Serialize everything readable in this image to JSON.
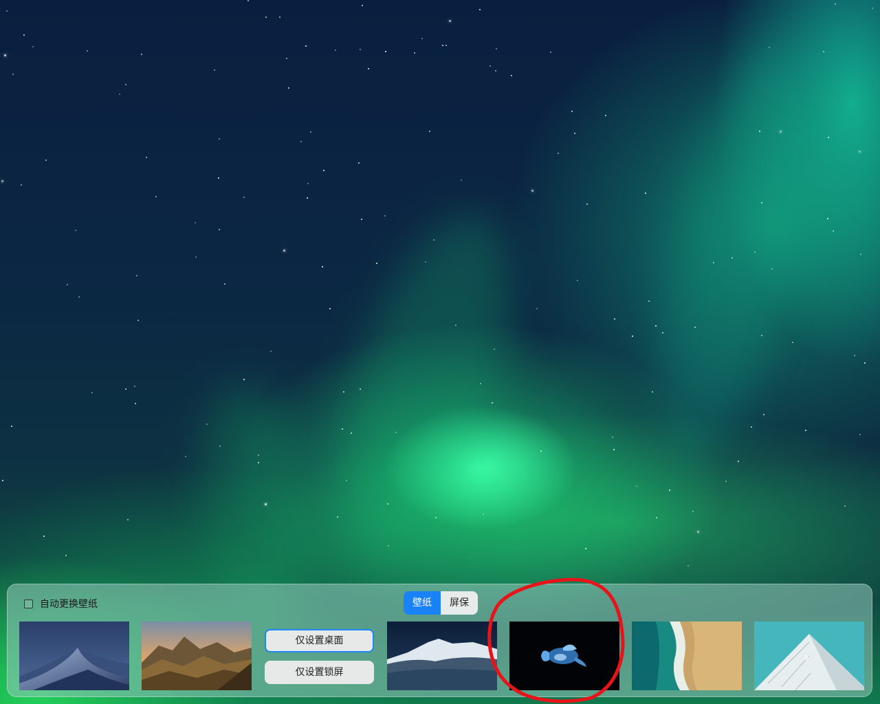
{
  "panel": {
    "auto_change_label": "自动更换壁纸",
    "tabs": [
      {
        "label": "壁纸",
        "active": true
      },
      {
        "label": "屏保",
        "active": false
      }
    ],
    "buttons": {
      "desktop_only": "仅设置桌面",
      "lockscreen_only": "仅设置锁屏"
    },
    "next_icon": "chevron-right-icon"
  },
  "colors": {
    "accent": "#1a82f7",
    "annotation": "#e8141a"
  }
}
